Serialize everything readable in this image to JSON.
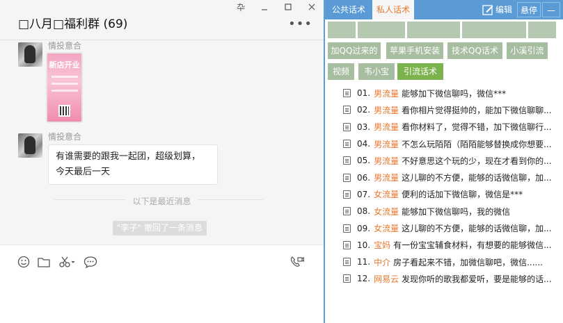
{
  "window": {
    "pin": "卆",
    "minimize": "□",
    "maximize": "□",
    "close": "✕"
  },
  "chat": {
    "title": "□八月□福利群 (69)",
    "more": "•••",
    "messages": [
      {
        "sender": "情投意合",
        "type": "image",
        "poster_title": "新店开业"
      },
      {
        "sender": "情投意合",
        "type": "text",
        "lines": [
          "有谁需要的跟我一起团，超级划算，",
          "今天最后一天"
        ]
      }
    ],
    "divider": "以下是最近消息",
    "recall": "\"李子\" 撤回了一条消息"
  },
  "toolbar": {
    "icons": [
      "emoji-icon",
      "folder-icon",
      "scissors-icon",
      "chat-bubble-icon",
      "video-call-icon"
    ]
  },
  "panel": {
    "tabs": [
      "公共话术",
      "私人话术"
    ],
    "active_tab": "私人话术",
    "edit_label": "编辑",
    "pin_label": "悬停",
    "collapse_label": "—",
    "categories": [
      "加QQ过来的",
      "苹果手机安装",
      "技术QQ话术",
      "小溪引流",
      "视频",
      "韦小宝",
      "引流话术"
    ],
    "active_category": "引流话术",
    "phrases": [
      {
        "num": "01.",
        "tag": "男流量",
        "text": "能够加下微信聊吗，微信***"
      },
      {
        "num": "02.",
        "tag": "男流量",
        "text": "看你相片觉得挺帅的，能加下微信聊聊..."
      },
      {
        "num": "03.",
        "tag": "男流量",
        "text": "看你材料了，觉得不错，加下微信聊行..."
      },
      {
        "num": "04.",
        "tag": "男流量",
        "text": "不怎么玩陌陌（陌陌能够替换成你想要..."
      },
      {
        "num": "05.",
        "tag": "男流量",
        "text": "不好意思这个玩的少，现在才看到你的..."
      },
      {
        "num": "06.",
        "tag": "男流量",
        "text": "这儿聊的不方便，能够的话微信聊，加..."
      },
      {
        "num": "07.",
        "tag": "女流量",
        "text": "便利的话加下微信聊，微信是***"
      },
      {
        "num": "08.",
        "tag": "女流量",
        "text": "能够加下微信聊吗，我的微信"
      },
      {
        "num": "09.",
        "tag": "女流量",
        "text": "这儿聊的不方便，能够的话微信聊，加..."
      },
      {
        "num": "10.",
        "tag": "宝妈",
        "text": "有一份宝宝辅食材料，有想要的能够微信..."
      },
      {
        "num": "11.",
        "tag": "中介",
        "text": "房子看起来不错，加微信聊吧，微信......"
      },
      {
        "num": "12.",
        "tag": "网易云",
        "text": "发现你听的歌我都爱听，要是能够的话..."
      }
    ]
  },
  "colors": {
    "accent": "#5b9bd5",
    "tag": "#e8772e",
    "category": "#a6bda0",
    "category_active": "#7cb34c"
  }
}
